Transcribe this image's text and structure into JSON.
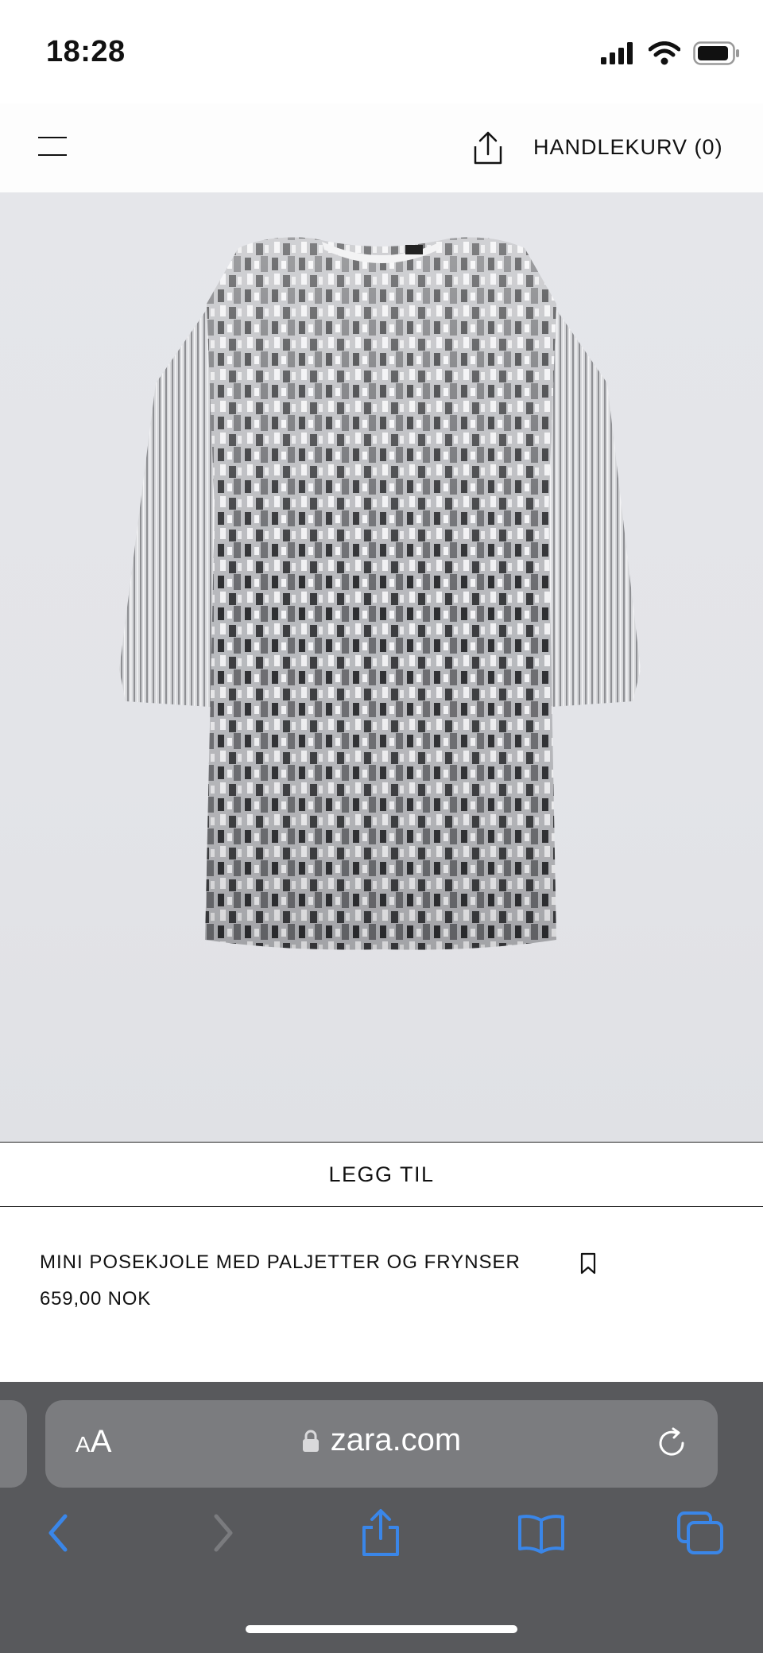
{
  "status_bar": {
    "time": "18:28"
  },
  "header": {
    "cart_label": "HANDLEKURV (0)"
  },
  "product": {
    "add_label": "LEGG TIL",
    "name": "MINI POSEKJOLE MED PALJETTER OG FRYNSER",
    "price": "659,00 NOK"
  },
  "browser": {
    "aa_small": "A",
    "aa_big": "A",
    "url": "zara.com"
  },
  "colors": {
    "accent": "#3a86e8",
    "toolbar_bg": "#58595c",
    "urlbar_bg": "#7b7c7f"
  },
  "icons": [
    "signal-icon",
    "wifi-icon",
    "battery-icon",
    "menu-icon",
    "share-icon",
    "bookmark-icon",
    "lock-icon",
    "reload-icon",
    "back-icon",
    "forward-icon",
    "share-icon",
    "bookmarks-icon",
    "tabs-icon"
  ]
}
